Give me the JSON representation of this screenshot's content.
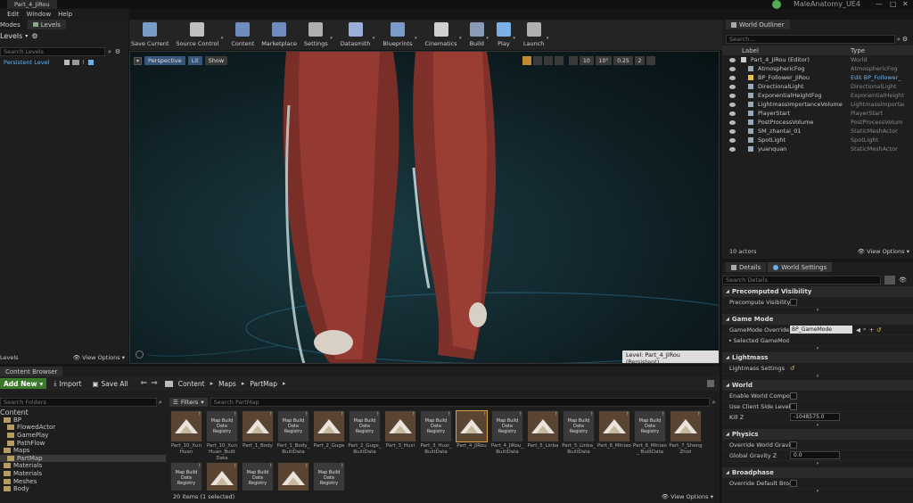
{
  "title_bar": {
    "doc_tab": "Part_4_JiRou",
    "project": "MaleAnatomy_UE4"
  },
  "menu": [
    "Edit",
    "Window",
    "Help"
  ],
  "left_panel": {
    "tabs": [
      "Modes",
      "Levels"
    ],
    "title": "Levels",
    "search_placeholder": "Search Levels",
    "level": "Persistent Level",
    "footer_label": "Levels",
    "view_options": "View Options"
  },
  "toolbar": [
    {
      "label": "Save Current",
      "icon": "save-icon",
      "color": "#7a9cc8",
      "dd": false
    },
    {
      "label": "Source Control",
      "icon": "source-control-icon",
      "color": "#c0c0c0",
      "dd": true
    },
    {
      "label": "Content",
      "icon": "content-icon",
      "color": "#6e8cc0",
      "dd": false
    },
    {
      "label": "Marketplace",
      "icon": "marketplace-icon",
      "color": "#6e8cc0",
      "dd": false
    },
    {
      "label": "Settings",
      "icon": "gear-icon",
      "color": "#b0b0b0",
      "dd": true
    },
    {
      "label": "Datasmith",
      "icon": "datasmith-icon",
      "color": "#9ab0d8",
      "dd": true
    },
    {
      "label": "Blueprints",
      "icon": "blueprints-icon",
      "color": "#7a9cc8",
      "dd": true
    },
    {
      "label": "Cinematics",
      "icon": "cinematics-icon",
      "color": "#d0d0d0",
      "dd": true
    },
    {
      "label": "Build",
      "icon": "build-icon",
      "color": "#8a9ab8",
      "dd": true
    },
    {
      "label": "Play",
      "icon": "play-icon",
      "color": "#7ab0e8",
      "dd": true
    },
    {
      "label": "Launch",
      "icon": "launch-icon",
      "color": "#b0b0b0",
      "dd": true
    }
  ],
  "viewport": {
    "perspective": "Perspective",
    "lit": "Lit",
    "show": "Show",
    "right_tools": [
      "10",
      "10°",
      "0.25",
      "2"
    ],
    "level_label": "Level:  Part_4_JiRou (Persistent)"
  },
  "outliner": {
    "tab": "World Outliner",
    "search_placeholder": "Search...",
    "col_label": "Label",
    "col_type": "Type",
    "rows": [
      {
        "label": "Part_4_JiRou (Editor)",
        "type": "World"
      },
      {
        "label": "AtmosphericFog",
        "type": "AtmosphericFog"
      },
      {
        "label": "BP_Follower_JiRou",
        "type": "Edit BP_Follower_"
      },
      {
        "label": "DirectionalLight",
        "type": "DirectionalLight"
      },
      {
        "label": "ExponentialHeightFog",
        "type": "ExponentialHeightF"
      },
      {
        "label": "LightmassImportanceVolume",
        "type": "LightmassImportan"
      },
      {
        "label": "PlayerStart",
        "type": "PlayerStart"
      },
      {
        "label": "PostProcessVolume",
        "type": "PostProcessVolum"
      },
      {
        "label": "SM_zhantai_01",
        "type": "StaticMeshActor"
      },
      {
        "label": "SpotLight",
        "type": "SpotLight"
      },
      {
        "label": "yuanquan",
        "type": "StaticMeshActor"
      }
    ],
    "count": "10 actors",
    "view_options": "View Options"
  },
  "details": {
    "tabs": [
      "Details",
      "World Settings"
    ],
    "search_placeholder": "Search Details",
    "sections": [
      {
        "title": "Precomputed Visibility",
        "props": [
          {
            "name": "Precompute Visibility",
            "kind": "check"
          }
        ]
      },
      {
        "title": "Game Mode",
        "props": [
          {
            "name": "GameMode Override",
            "kind": "select",
            "value": "BP_GameMode"
          },
          {
            "name": "Selected GameMode",
            "kind": "expand"
          }
        ]
      },
      {
        "title": "Lightmass",
        "props": [
          {
            "name": "Lightmass Settings",
            "kind": "reset"
          }
        ]
      },
      {
        "title": "World",
        "props": [
          {
            "name": "Enable World Composit",
            "kind": "check"
          },
          {
            "name": "Use Client Side Level S",
            "kind": "check"
          },
          {
            "name": "Kill Z",
            "kind": "number",
            "value": "-1048575.0"
          }
        ]
      },
      {
        "title": "Physics",
        "props": [
          {
            "name": "Override World Gravity",
            "kind": "check"
          },
          {
            "name": "Global Gravity Z",
            "kind": "number",
            "value": "0.0"
          }
        ]
      },
      {
        "title": "Broadphase",
        "props": [
          {
            "name": "Override Default Broadp",
            "kind": "check"
          }
        ]
      }
    ]
  },
  "content_browser": {
    "tab": "Content Browser",
    "add_new": "Add New",
    "import": "Import",
    "save_all": "Save All",
    "path": [
      "Content",
      "Maps",
      "PartMap"
    ],
    "folders_search": "Search Folders",
    "filters": "Filters",
    "search_placeholder": "Search PartMap",
    "tree": [
      {
        "name": "Content",
        "depth": 0
      },
      {
        "name": "BP",
        "depth": 1
      },
      {
        "name": "FlowedActor",
        "depth": 2
      },
      {
        "name": "GamePlay",
        "depth": 2
      },
      {
        "name": "PathFlow",
        "depth": 2
      },
      {
        "name": "Maps",
        "depth": 1
      },
      {
        "name": "PartMap",
        "depth": 2,
        "sel": true
      },
      {
        "name": "Materials",
        "depth": 1
      },
      {
        "name": "Materials",
        "depth": 1
      },
      {
        "name": "Meshes",
        "depth": 1
      },
      {
        "name": "Body",
        "depth": 1
      }
    ],
    "assets": [
      {
        "name": "Part_10_Xun Huan",
        "kind": "map"
      },
      {
        "name": "Part_10_Xun Huan_Built Data",
        "kind": "reg"
      },
      {
        "name": "Part_1_Body",
        "kind": "map"
      },
      {
        "name": "Part_1_Body_ BuiltData",
        "kind": "reg"
      },
      {
        "name": "Part_2_Guge",
        "kind": "map"
      },
      {
        "name": "Part_2_Guge_ BuiltData",
        "kind": "reg"
      },
      {
        "name": "Part_3_Huxi",
        "kind": "map"
      },
      {
        "name": "Part_3_Huxi_ BuiltData",
        "kind": "reg"
      },
      {
        "name": "Part_4_JiRou",
        "kind": "map",
        "sel": true
      },
      {
        "name": "Part_4_JiRou_ BuiltData",
        "kind": "reg"
      },
      {
        "name": "Part_5_Linba",
        "kind": "map"
      },
      {
        "name": "Part_5_Linba_ BuiltData",
        "kind": "reg"
      },
      {
        "name": "Part_6_Miniao",
        "kind": "map"
      },
      {
        "name": "Part_6_Miniao_ BuiltData",
        "kind": "reg"
      },
      {
        "name": "Part_7_Sheng Zhizi",
        "kind": "map"
      },
      {
        "name": "",
        "kind": "reg"
      },
      {
        "name": "",
        "kind": "map"
      },
      {
        "name": "",
        "kind": "reg"
      },
      {
        "name": "",
        "kind": "map"
      },
      {
        "name": "",
        "kind": "reg"
      }
    ],
    "reg_label": "Map Build Data Registry",
    "status": "20 items (1 selected)",
    "view_options": "View Options"
  }
}
